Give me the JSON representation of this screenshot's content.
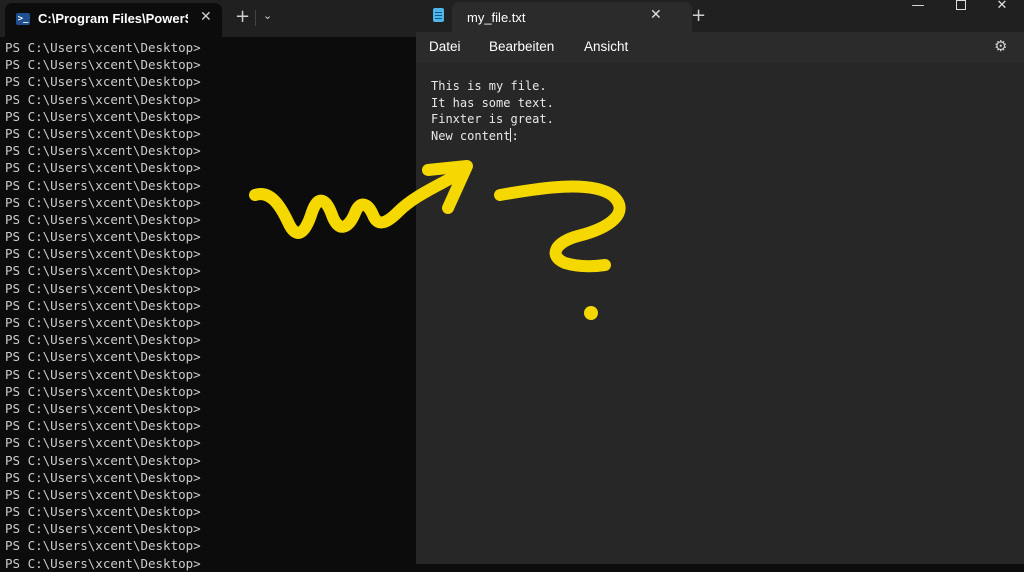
{
  "terminal": {
    "tab_title": "C:\\Program Files\\PowerS",
    "close_glyph": "✕",
    "new_tab_glyph": "+",
    "dropdown_glyph": "⌄",
    "icon_glyph": ">_",
    "lines": [
      "PS C:\\Users\\xcent\\Desktop>",
      "PS C:\\Users\\xcent\\Desktop>",
      "PS C:\\Users\\xcent\\Desktop>",
      "PS C:\\Users\\xcent\\Desktop>",
      "PS C:\\Users\\xcent\\Desktop>",
      "PS C:\\Users\\xcent\\Desktop>",
      "PS C:\\Users\\xcent\\Desktop>",
      "PS C:\\Users\\xcent\\Desktop>",
      "PS C:\\Users\\xcent\\Desktop>",
      "PS C:\\Users\\xcent\\Desktop>",
      "PS C:\\Users\\xcent\\Desktop>",
      "PS C:\\Users\\xcent\\Desktop>",
      "PS C:\\Users\\xcent\\Desktop>",
      "PS C:\\Users\\xcent\\Desktop>",
      "PS C:\\Users\\xcent\\Desktop>",
      "PS C:\\Users\\xcent\\Desktop>",
      "PS C:\\Users\\xcent\\Desktop>",
      "PS C:\\Users\\xcent\\Desktop>",
      "PS C:\\Users\\xcent\\Desktop>",
      "PS C:\\Users\\xcent\\Desktop>",
      "PS C:\\Users\\xcent\\Desktop>",
      "PS C:\\Users\\xcent\\Desktop>",
      "PS C:\\Users\\xcent\\Desktop>",
      "PS C:\\Users\\xcent\\Desktop>",
      "PS C:\\Users\\xcent\\Desktop>",
      "PS C:\\Users\\xcent\\Desktop>",
      "PS C:\\Users\\xcent\\Desktop>",
      "PS C:\\Users\\xcent\\Desktop>",
      "PS C:\\Users\\xcent\\Desktop>",
      "PS C:\\Users\\xcent\\Desktop>",
      "PS C:\\Users\\xcent\\Desktop>"
    ]
  },
  "notepad": {
    "tab_title": "my_file.txt",
    "close_glyph": "✕",
    "new_tab_glyph": "+",
    "window_controls": {
      "minimize": "—",
      "close": "✕"
    },
    "menu": {
      "file": "Datei",
      "edit": "Bearbeiten",
      "view": "Ansicht"
    },
    "settings_glyph": "⚙",
    "content_lines": [
      "This is my file.",
      "It has some text.",
      "Finxter is great.",
      "New content"
    ],
    "after_caret": ":"
  },
  "colors": {
    "annotation_ink": "#f5d800",
    "terminal_bg": "#0c0c0c",
    "notepad_bg": "#272727"
  }
}
